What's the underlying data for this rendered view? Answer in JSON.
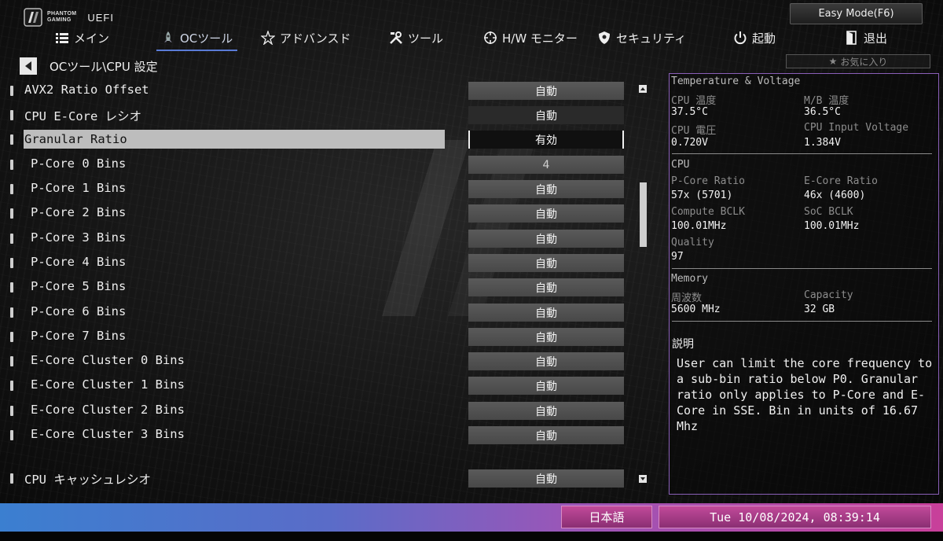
{
  "header": {
    "logo_line1": "PHANTOM",
    "logo_line2": "GAMING",
    "logo_uefi": "UEFI",
    "easy_mode": "Easy Mode(F6)"
  },
  "nav": {
    "items": [
      {
        "label": "メイン",
        "icon": "list-icon"
      },
      {
        "label": "OCツール",
        "icon": "rocket-icon",
        "active": true
      },
      {
        "label": "アドバンスド",
        "icon": "star-icon"
      },
      {
        "label": "ツール",
        "icon": "tools-icon"
      },
      {
        "label": "H/W モニター",
        "icon": "crosshair-icon"
      },
      {
        "label": "セキュリティ",
        "icon": "shield-icon"
      },
      {
        "label": "起動",
        "icon": "power-icon"
      },
      {
        "label": "退出",
        "icon": "exit-icon"
      }
    ]
  },
  "breadcrumb": "OCツール\\CPU 設定",
  "favorites": "お気に入り",
  "settings": [
    {
      "label": "AVX2 Ratio Offset",
      "value": "自動"
    },
    {
      "label": "CPU E-Core レシオ",
      "value": "自動"
    },
    {
      "label": "Granular Ratio",
      "value": "有効"
    },
    {
      "label": "P-Core 0 Bins",
      "value": "4"
    },
    {
      "label": "P-Core 1 Bins",
      "value": "自動"
    },
    {
      "label": "P-Core 2 Bins",
      "value": "自動"
    },
    {
      "label": "P-Core 3 Bins",
      "value": "自動"
    },
    {
      "label": "P-Core 4 Bins",
      "value": "自動"
    },
    {
      "label": "P-Core 5 Bins",
      "value": "自動"
    },
    {
      "label": "P-Core 6 Bins",
      "value": "自動"
    },
    {
      "label": "P-Core 7 Bins",
      "value": "自動"
    },
    {
      "label": "E-Core Cluster 0 Bins",
      "value": "自動"
    },
    {
      "label": "E-Core Cluster 1 Bins",
      "value": "自動"
    },
    {
      "label": "E-Core Cluster 2 Bins",
      "value": "自動"
    },
    {
      "label": "E-Core Cluster 3 Bins",
      "value": "自動"
    },
    {
      "label": "CPU  キャッシュレシオ",
      "value": "自動"
    }
  ],
  "panel": {
    "tv_title": "Temperature & Voltage",
    "cpu_temp_label": "CPU 温度",
    "cpu_temp": "37.5°C",
    "mb_temp_label": "M/B 温度",
    "mb_temp": "36.5°C",
    "cpu_volt_label": "CPU 電圧",
    "cpu_volt": "0.720V",
    "cpu_input_label": "CPU Input Voltage",
    "cpu_input": "1.384V",
    "cpu_title": "CPU",
    "pcore_label": "P-Core Ratio",
    "pcore": "57x (5701)",
    "ecore_label": "E-Core Ratio",
    "ecore": "46x (4600)",
    "cbclk_label": "Compute BCLK",
    "cbclk": "100.01MHz",
    "socbclk_label": "SoC BCLK",
    "socbclk": "100.01MHz",
    "quality_label": "Quality",
    "quality": "97",
    "mem_title": "Memory",
    "freq_label": "周波数",
    "freq": "5600 MHz",
    "cap_label": "Capacity",
    "cap": "32 GB",
    "desc_title": "説明",
    "desc_text": "User can limit the core frequency to a sub-bin ratio below P0. Granular ratio only applies to P-Core and E-Core in SSE. Bin in units of 16.67 Mhz"
  },
  "footer": {
    "language": "日本語",
    "datetime": "Tue 10/08/2024, 08:39:14"
  },
  "colors": {
    "panel_border": "#8a5fb8",
    "nav_active": "#5a7bd6",
    "footer_start": "#3b7fd0",
    "footer_end": "#c8409a"
  }
}
